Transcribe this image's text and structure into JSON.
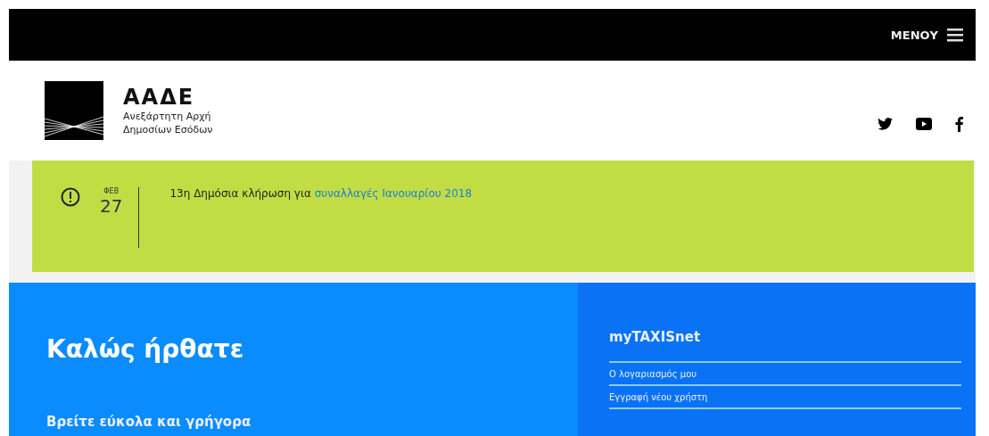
{
  "top_bar": {
    "menu_label": "ΜΕΝΟΥ"
  },
  "header": {
    "logo_title": "ΑΑΔΕ",
    "logo_subtitle_lines": [
      "Ανεξάρτητη Αρχή",
      "Δημοσίων Εσόδων"
    ],
    "social": [
      {
        "kind": "twitter"
      },
      {
        "kind": "youtube"
      },
      {
        "kind": "facebook"
      }
    ]
  },
  "announcement": {
    "month": "ΦΕΒ",
    "day": "27",
    "text": "13η Δημόσια κλήρωση για ",
    "link": "συναλλαγές Ιανουαρίου 2018"
  },
  "welcome": {
    "title": "Καλώς ήρθατε",
    "subtitle": "Βρείτε εύκολα και γρήγορα"
  },
  "sidebar": {
    "title": "myTAXISnet",
    "items": [
      "Ο λογαριασμός μου",
      "Εγγραφή νέου χρήστη"
    ]
  }
}
